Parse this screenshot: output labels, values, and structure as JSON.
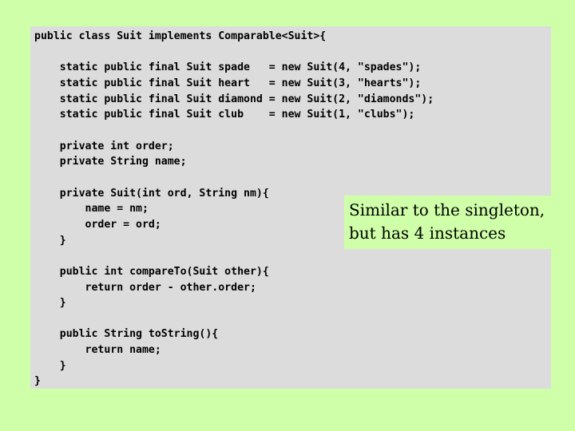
{
  "slide": {
    "background_color": "#cfffa8",
    "code_panel": {
      "background_color": "#dcdcdc",
      "language": "java",
      "listing": "public class Suit implements Comparable<Suit>{\n\n    static public final Suit spade   = new Suit(4, \"spades\");\n    static public final Suit heart   = new Suit(3, \"hearts\");\n    static public final Suit diamond = new Suit(2, \"diamonds\");\n    static public final Suit club    = new Suit(1, \"clubs\");\n\n    private int order;\n    private String name;\n\n    private Suit(int ord, String nm){\n        name = nm;\n        order = ord;\n    }\n\n    public int compareTo(Suit other){\n        return order - other.order;\n    }\n\n    public String toString(){\n        return name;\n    }\n}",
      "lines": [
        "public class Suit implements Comparable<Suit>{",
        "",
        "    static public final Suit spade   = new Suit(4, \"spades\");",
        "    static public final Suit heart   = new Suit(3, \"hearts\");",
        "    static public final Suit diamond = new Suit(2, \"diamonds\");",
        "    static public final Suit club    = new Suit(1, \"clubs\");",
        "",
        "    private int order;",
        "    private String name;",
        "",
        "    private Suit(int ord, String nm){",
        "        name = nm;",
        "        order = ord;",
        "    }",
        "",
        "    public int compareTo(Suit other){",
        "        return order - other.order;",
        "    }",
        "",
        "    public String toString(){",
        "        return name;",
        "    }",
        "}"
      ],
      "constants": [
        {
          "name": "spade",
          "order": "4",
          "label": "\"spades\""
        },
        {
          "name": "heart",
          "order": "3",
          "label": "\"hearts\""
        },
        {
          "name": "diamond",
          "order": "2",
          "label": "\"diamonds\""
        },
        {
          "name": "club",
          "order": "1",
          "label": "\"clubs\""
        }
      ]
    },
    "callout": {
      "background_color": "#cfffa8",
      "line1": "Similar to the singleton,",
      "line2": "but has 4 instances"
    }
  }
}
